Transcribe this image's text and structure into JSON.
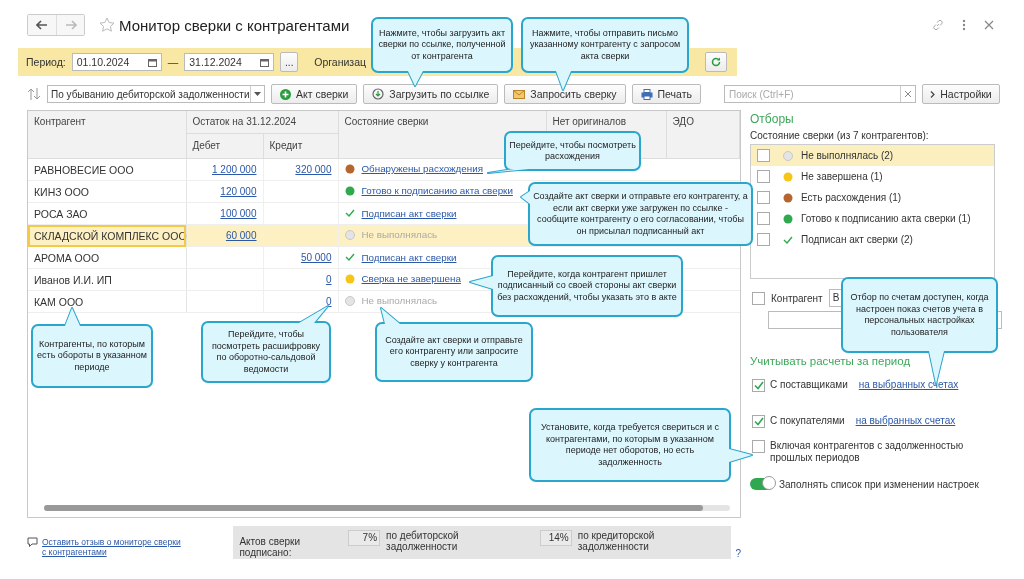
{
  "window": {
    "title": "Монитор сверки с контрагентами"
  },
  "filter": {
    "period_label": "Период:",
    "date_from": "01.10.2024",
    "separator": "—",
    "date_to": "31.12.2024",
    "more_button": "...",
    "organization_label": "Организац"
  },
  "toolbar": {
    "sort": "По убыванию дебиторской задолженности",
    "buttons": [
      {
        "label": "Акт сверки",
        "kind": "add"
      },
      {
        "label": "Загрузить по ссылке",
        "kind": "load"
      },
      {
        "label": "Запросить сверку",
        "kind": "mail"
      },
      {
        "label": "Печать",
        "kind": "print"
      }
    ],
    "search": {
      "placeholder": "Поиск (Ctrl+F)"
    },
    "settings_button": "Настройки"
  },
  "table": {
    "columns": {
      "counterparty": "Контрагент",
      "balance": "Остаток на 31.12.2024",
      "debit": "Дебет",
      "credit": "Кредит",
      "status": "Состояние сверки",
      "no_originals": "Нет оригиналов",
      "edo": "ЭДО"
    },
    "rows": [
      {
        "counterparty": "РАВНОВЕСИЕ ООО",
        "debit": "1 200 000",
        "credit": "320 000",
        "status": {
          "kind": "dot",
          "color": "#b5652e",
          "text": "Обнаружены расхождения",
          "link": true
        },
        "selected": false
      },
      {
        "counterparty": "КИНЗ ООО",
        "debit": "120 000",
        "status": {
          "kind": "dot",
          "color": "#2fa84f",
          "text": "Готово к подписанию акта сверки",
          "link": true
        },
        "selected": false
      },
      {
        "counterparty": "РОСА ЗАО",
        "debit": "100 000",
        "status": {
          "kind": "check",
          "text": "Подписан акт сверки",
          "link": true
        },
        "selected": false
      },
      {
        "counterparty": "СКЛАДСКОЙ КОМПЛЕКС ООО",
        "debit": "60 000",
        "status": {
          "kind": "dot",
          "color": "#e4e4e4",
          "text": "Не выполнялась",
          "link": false
        },
        "selected": true
      },
      {
        "counterparty": "АРОМА ООО",
        "credit": "50 000",
        "status": {
          "kind": "check",
          "text": "Подписан акт сверки",
          "link": true
        },
        "selected": false
      },
      {
        "counterparty": "Иванов И.И. ИП",
        "credit": "0",
        "status": {
          "kind": "dot",
          "color": "#f5c518",
          "text": "Сверка не завершена",
          "link": true
        },
        "selected": false
      },
      {
        "counterparty": "КАМ ООО",
        "credit": "0",
        "status": {
          "kind": "dot",
          "color": "#e4e4e4",
          "text": "Не выполнялась",
          "link": false
        },
        "selected": false
      }
    ]
  },
  "footer": {
    "feedback_link": "Оставить отзыв о мониторе сверки с контрагентами",
    "signed_label": "Актов сверки подписано:",
    "stats": [
      {
        "value": "7%",
        "label": "по дебиторской задолженности"
      },
      {
        "value": "14%",
        "label": "по кредиторской задолженности"
      }
    ],
    "help": "?"
  },
  "filters": {
    "title": "Отборы",
    "status_caption": "Состояние сверки (из 7 контрагентов):",
    "statuses": [
      {
        "label": "Не выполнялась (2)",
        "kind": "dot",
        "color": "#e4e4e4",
        "checked": false,
        "selected": true
      },
      {
        "label": "Не завершена (1)",
        "kind": "dot",
        "color": "#f5c518",
        "checked": false,
        "selected": false
      },
      {
        "label": "Есть расхождения (1)",
        "kind": "dot",
        "color": "#b5652e",
        "checked": false,
        "selected": false
      },
      {
        "label": "Готово к подписанию акта сверки (1)",
        "kind": "dot",
        "color": "#2fa84f",
        "checked": false,
        "selected": false
      },
      {
        "label": "Подписан акт сверки (2)",
        "kind": "check",
        "checked": false,
        "selected": false
      }
    ],
    "counterparty": {
      "label": "Контрагент",
      "checked": false,
      "mode": "В"
    },
    "period_title": "Учитывать расчеты за период",
    "options": [
      {
        "label": "С поставщиками",
        "checked": true,
        "link": "на выбранных счетах"
      },
      {
        "label": "С покупателями",
        "checked": true,
        "link": "на выбранных счетах"
      },
      {
        "label": "Включая контрагентов с задолженностью прошлых периодов",
        "checked": false
      }
    ],
    "toggle": {
      "label": "Заполнять список при изменении настроек",
      "on": true
    }
  },
  "callouts": [
    "Нажмите, чтобы загрузить акт сверки по ссылке, полученной от контрагента",
    "Нажмите, чтобы отправить письмо указанному контрагенту с запросом акта сверки",
    "Перейдите, чтобы посмотреть расхождения",
    "Создайте акт сверки и отправьте его контрагенту, а если акт сверки уже загружен по ссылке - сообщите контрагенту о его согласовании, чтобы он присылал подписанный акт",
    "Перейдите, когда контрагент пришлет подписанный со своей стороны акт сверки без расхождений, чтобы указать это в акте",
    "Контрагенты, по которым есть обороты в указанном периоде",
    "Перейдите, чтобы посмотреть расшифровку по оборотно-сальдовой ведомости",
    "Создайте акт сверки и отправьте его контрагенту или запросите сверку у контрагента",
    "Установите, когда требуется свериться и с контрагентами, по которым в указанном периоде нет оборотов, но есть задолженность",
    "Отбор по счетам доступен, когда настроен показ счетов учета в персональных настройках пользователя"
  ]
}
